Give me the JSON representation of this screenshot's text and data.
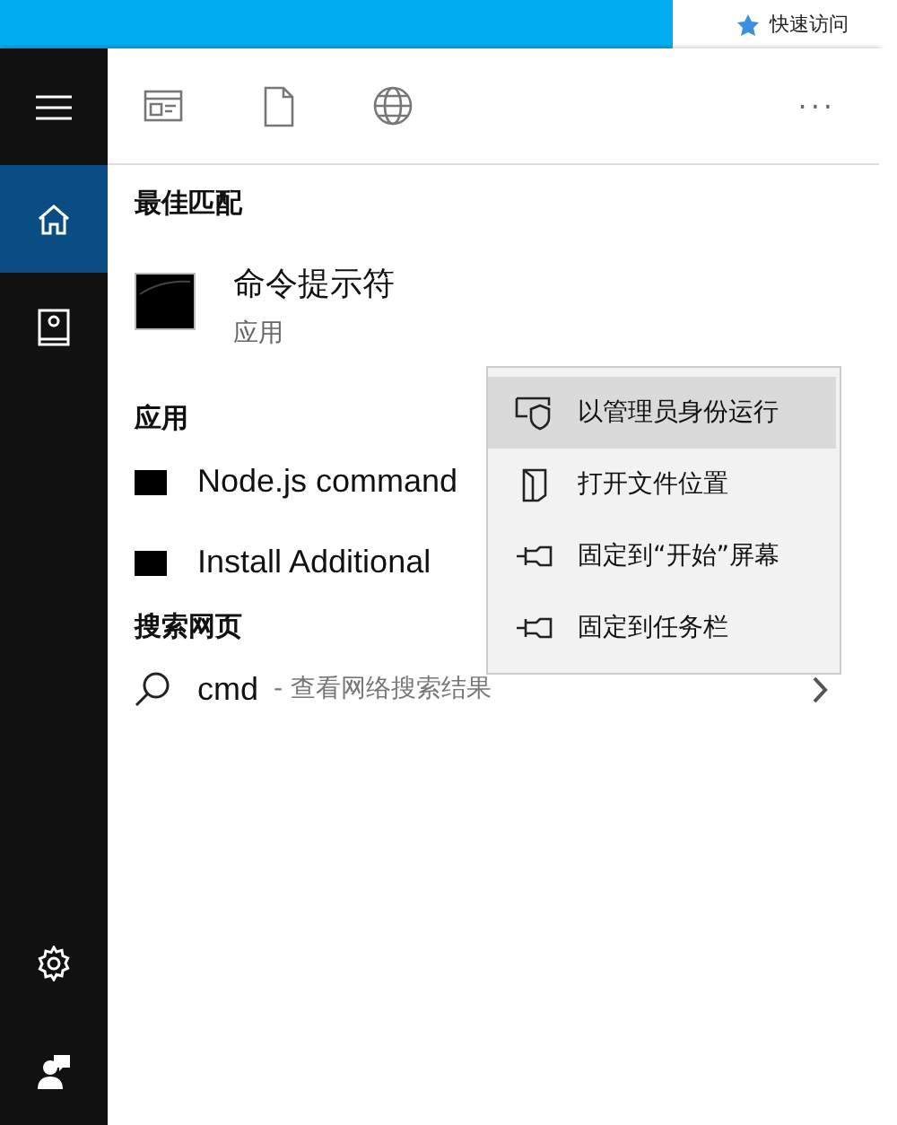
{
  "background": {
    "quick_access": "快速访问"
  },
  "sidebar": {
    "items": [
      {
        "selected": false
      },
      {
        "selected": true
      },
      {
        "selected": false
      }
    ],
    "bottom_items": [
      {
        "selected": false
      },
      {
        "selected": false
      }
    ]
  },
  "filters": {
    "items": [
      {
        "selected": false
      },
      {
        "selected": false
      },
      {
        "selected": false
      }
    ],
    "more": "···"
  },
  "best_match": {
    "heading": "最佳匹配",
    "title": "命令提示符",
    "subtitle": "应用"
  },
  "apps": {
    "heading": "应用",
    "items": [
      {
        "title": "Node.js command"
      },
      {
        "title": "Install Additional"
      }
    ]
  },
  "web": {
    "heading": "搜索网页",
    "query": "cmd",
    "hint": " - 查看网络搜索结果"
  },
  "context_menu": {
    "items": [
      {
        "label": "以管理员身份运行",
        "selected": true
      },
      {
        "label": "打开文件位置",
        "selected": false
      },
      {
        "label": "固定到“开始”屏幕",
        "selected": false
      },
      {
        "label": "固定到任务栏",
        "selected": false
      }
    ]
  }
}
